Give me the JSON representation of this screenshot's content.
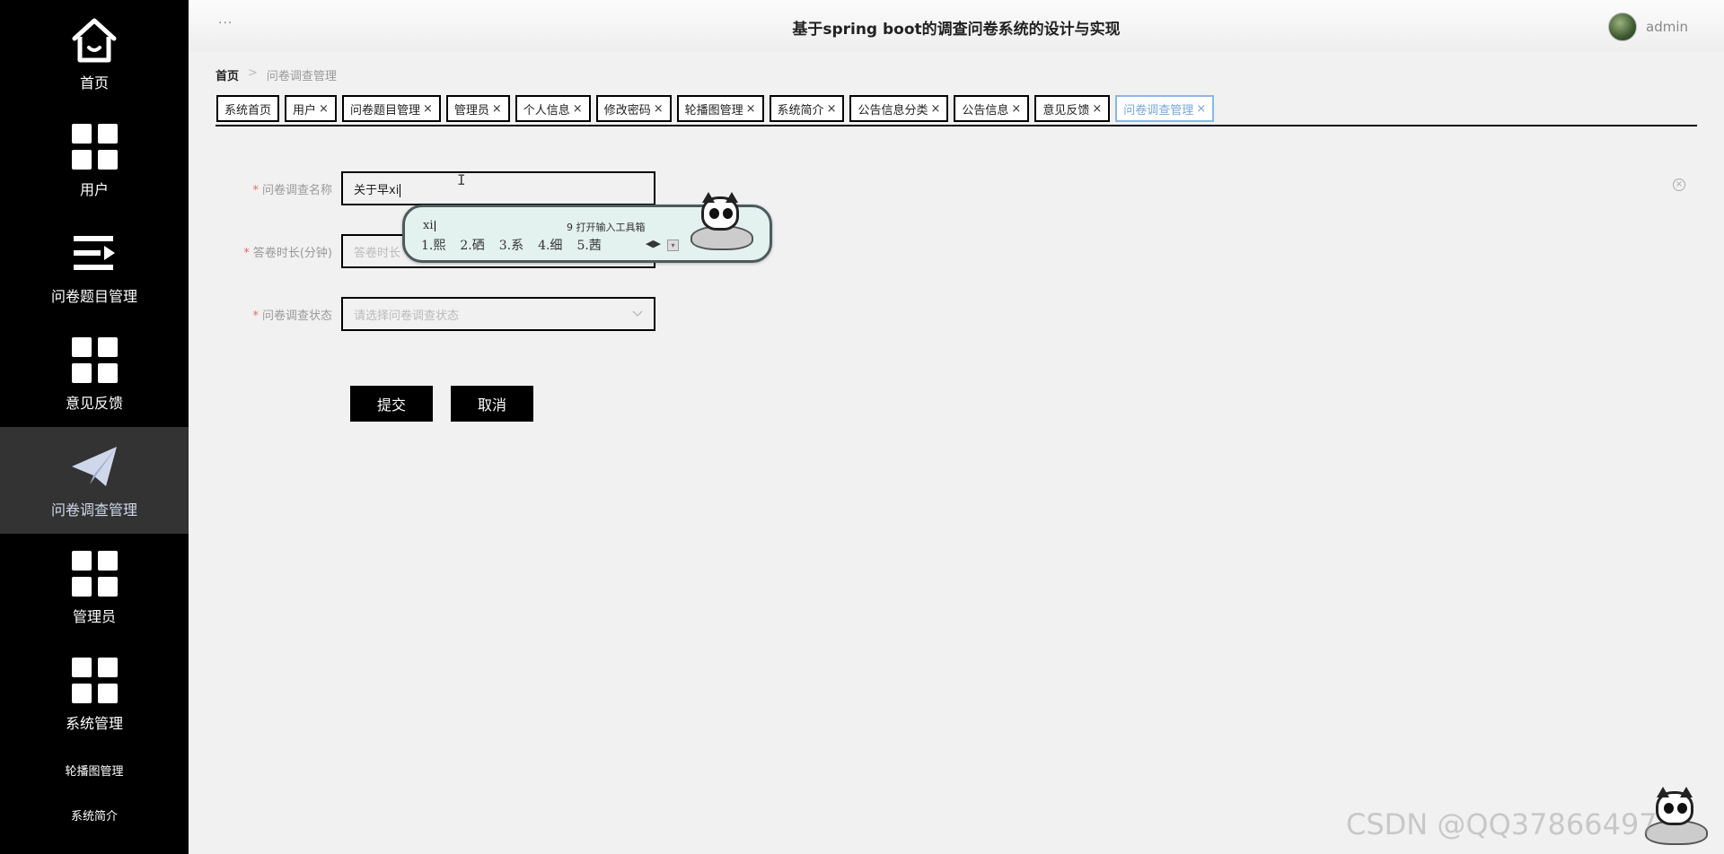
{
  "header": {
    "title": "基于spring boot的调查问卷系统的设计与实现",
    "menu_dots": "···",
    "username": "admin"
  },
  "sidebar": {
    "items": [
      {
        "label": "首页",
        "icon": "home-icon"
      },
      {
        "label": "用户",
        "icon": "grid-icon"
      },
      {
        "label": "问卷题目管理",
        "icon": "list-icon"
      },
      {
        "label": "意见反馈",
        "icon": "grid-icon"
      },
      {
        "label": "问卷调查管理",
        "icon": "paper-plane-icon",
        "active": true
      },
      {
        "label": "管理员",
        "icon": "grid-icon"
      },
      {
        "label": "系统管理",
        "icon": "grid-icon"
      }
    ],
    "subitems": [
      "轮播图管理",
      "系统简介"
    ]
  },
  "breadcrumb": {
    "home": "首页",
    "separator": ">",
    "current": "问卷调查管理"
  },
  "tabs": [
    {
      "label": "系统首页",
      "closable": false
    },
    {
      "label": "用户",
      "closable": true
    },
    {
      "label": "问卷题目管理",
      "closable": true
    },
    {
      "label": "管理员",
      "closable": true
    },
    {
      "label": "个人信息",
      "closable": true
    },
    {
      "label": "修改密码",
      "closable": true
    },
    {
      "label": "轮播图管理",
      "closable": true
    },
    {
      "label": "系统简介",
      "closable": true
    },
    {
      "label": "公告信息分类",
      "closable": true
    },
    {
      "label": "公告信息",
      "closable": true
    },
    {
      "label": "意见反馈",
      "closable": true
    },
    {
      "label": "问卷调查管理",
      "closable": true,
      "active": true
    }
  ],
  "tab_close": "×",
  "form": {
    "name_label": "问卷调查名称",
    "name_value": "关于早xi",
    "duration_label": "答卷时长(分钟)",
    "duration_placeholder": "答卷时长",
    "status_label": "问卷调查状态",
    "status_placeholder": "请选择问卷调查状态",
    "required_mark": "*",
    "submit_label": "提交",
    "cancel_label": "取消"
  },
  "ime": {
    "composition": "xi",
    "tip": "9 打开输入工具箱",
    "candidates": [
      "1.熙",
      "2.硒",
      "3.系",
      "4.细",
      "5.茜"
    ],
    "arrows": "◀▶"
  },
  "watermark": "CSDN @QQ37866497"
}
